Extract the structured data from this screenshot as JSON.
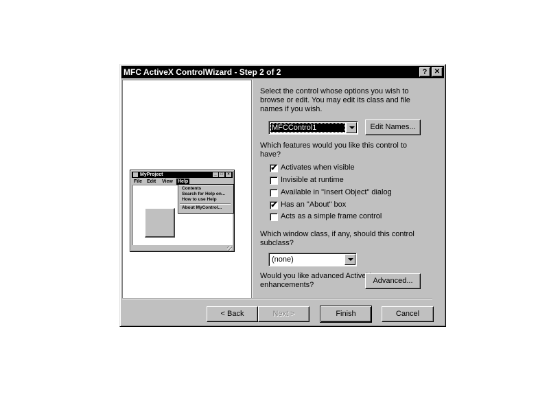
{
  "window": {
    "title": "MFC ActiveX ControlWizard - Step 2 of 2",
    "help_button": "?",
    "close_button": "✕"
  },
  "preview": {
    "title": "MyProject",
    "minimize": "_",
    "maximize": "□",
    "close": "×",
    "menu": [
      "File",
      "Edit",
      "View",
      "Help"
    ],
    "help_menu": {
      "items": [
        "Contents",
        "Search for Help on...",
        "How to use Help"
      ],
      "about": "About MyControl..."
    }
  },
  "control_select": {
    "prompt": "Select the control whose options you wish to browse or edit.  You may edit its class and file names if you wish.",
    "value": "MFCControl1",
    "edit_names_button": "Edit Names..."
  },
  "features": {
    "prompt": "Which features would you like this control to have?",
    "options": [
      {
        "label": "Activates when visible",
        "checked": true
      },
      {
        "label": "Invisible at runtime",
        "checked": false
      },
      {
        "label": "Available in \"Insert Object\" dialog",
        "checked": false
      },
      {
        "label": "Has an \"About\" box",
        "checked": true
      },
      {
        "label": "Acts as a simple frame control",
        "checked": false
      }
    ],
    "check_mark": "✔"
  },
  "subclass": {
    "prompt": "Which window class, if any, should this control subclass?",
    "value": "(none)"
  },
  "advanced": {
    "prompt": "Would you like advanced ActiveX enhancements?",
    "button": "Advanced..."
  },
  "footer": {
    "back": "< Back",
    "next": "Next >",
    "finish": "Finish",
    "cancel": "Cancel"
  }
}
